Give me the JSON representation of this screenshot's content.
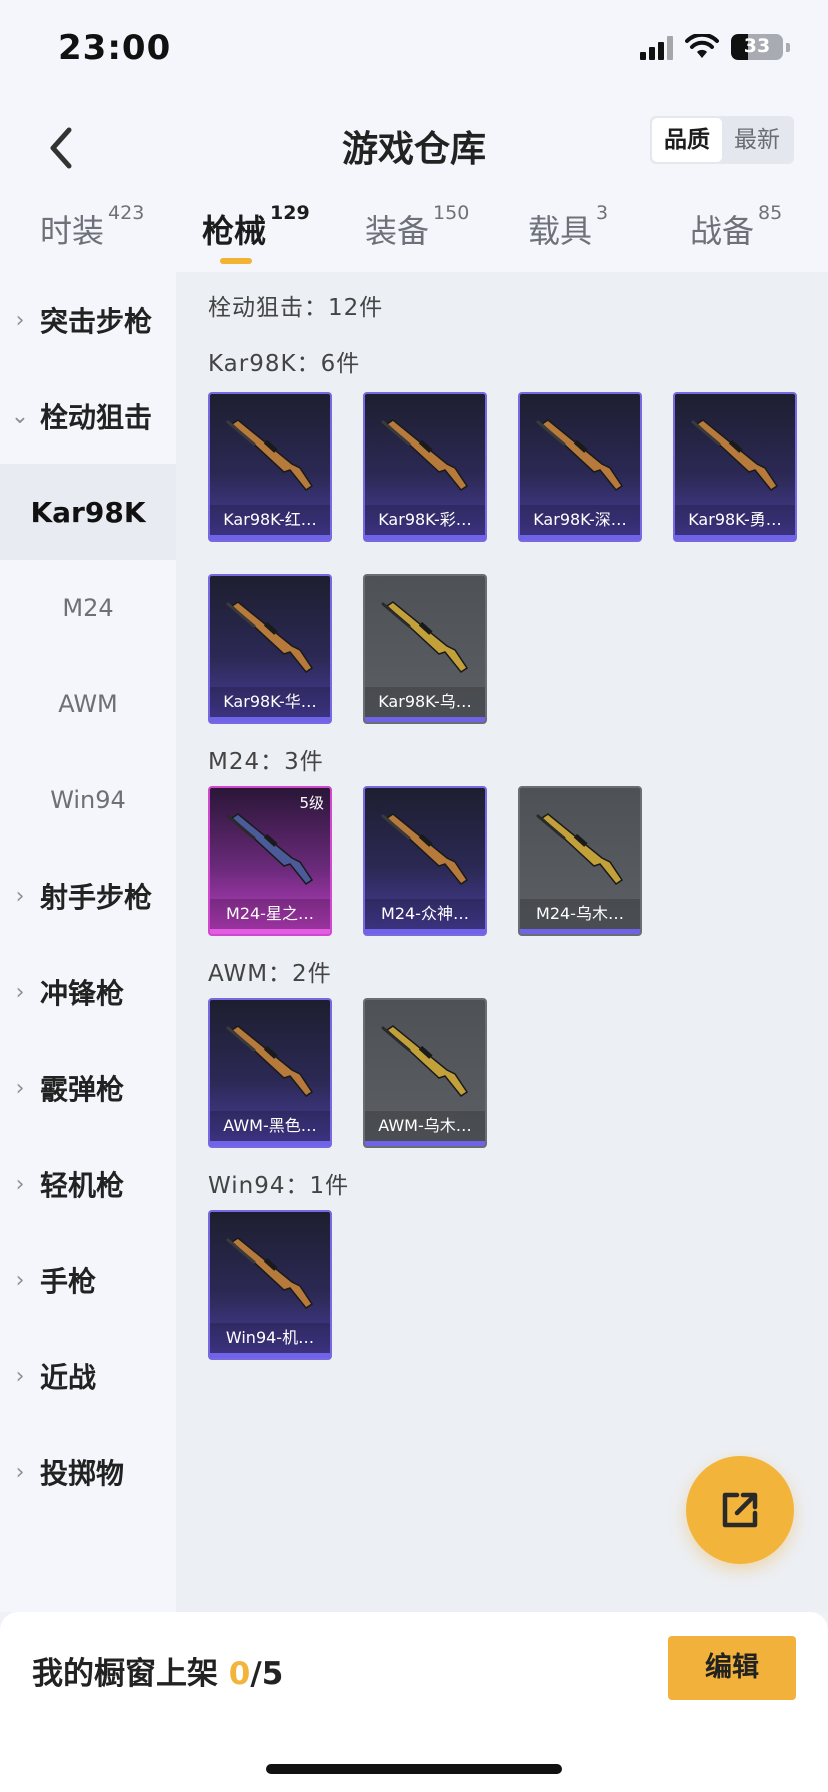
{
  "status": {
    "time": "23:00",
    "battery": "33",
    "battery_level": 0.33
  },
  "nav": {
    "title": "游戏仓库",
    "sort_quality": "品质",
    "sort_latest": "最新"
  },
  "tabs": [
    {
      "label": "时装",
      "count": "423"
    },
    {
      "label": "枪械",
      "count": "129"
    },
    {
      "label": "装备",
      "count": "150"
    },
    {
      "label": "载具",
      "count": "3"
    },
    {
      "label": "战备",
      "count": "85"
    }
  ],
  "sidebar": [
    {
      "label": "突击步枪"
    },
    {
      "label": "栓动狙击"
    },
    {
      "label": "Kar98K"
    },
    {
      "label": "M24"
    },
    {
      "label": "AWM"
    },
    {
      "label": "Win94"
    },
    {
      "label": "射手步枪"
    },
    {
      "label": "冲锋枪"
    },
    {
      "label": "霰弹枪"
    },
    {
      "label": "轻机枪"
    },
    {
      "label": "手枪"
    },
    {
      "label": "近战"
    },
    {
      "label": "投掷物"
    }
  ],
  "content": {
    "category_header": "栓动狙击：12件",
    "groups": [
      {
        "label": "Kar98K：6件",
        "items": [
          {
            "name": "Kar98K-红…",
            "rarity": "purple"
          },
          {
            "name": "Kar98K-彩…",
            "rarity": "purple"
          },
          {
            "name": "Kar98K-深…",
            "rarity": "purple"
          },
          {
            "name": "Kar98K-勇…",
            "rarity": "purple"
          },
          {
            "name": "Kar98K-华…",
            "rarity": "purple"
          },
          {
            "name": "Kar98K-乌…",
            "rarity": "gray"
          }
        ]
      },
      {
        "label": "M24：3件",
        "items": [
          {
            "name": "M24-星之…",
            "rarity": "pink",
            "level": "5级"
          },
          {
            "name": "M24-众神…",
            "rarity": "purple"
          },
          {
            "name": "M24-乌木…",
            "rarity": "gray"
          }
        ]
      },
      {
        "label": "AWM：2件",
        "items": [
          {
            "name": "AWM-黑色…",
            "rarity": "purple"
          },
          {
            "name": "AWM-乌木…",
            "rarity": "gray"
          }
        ]
      },
      {
        "label": "Win94：1件",
        "items": [
          {
            "name": "Win94-机…",
            "rarity": "purple"
          }
        ]
      }
    ]
  },
  "bottom": {
    "showcase_label": "我的橱窗上架 ",
    "current": "0",
    "total": "/5",
    "edit": "编辑"
  },
  "colors": {
    "accent": "#f3b43b",
    "purple_rarity": "#6f63e8",
    "pink_rarity": "#e35de1"
  }
}
